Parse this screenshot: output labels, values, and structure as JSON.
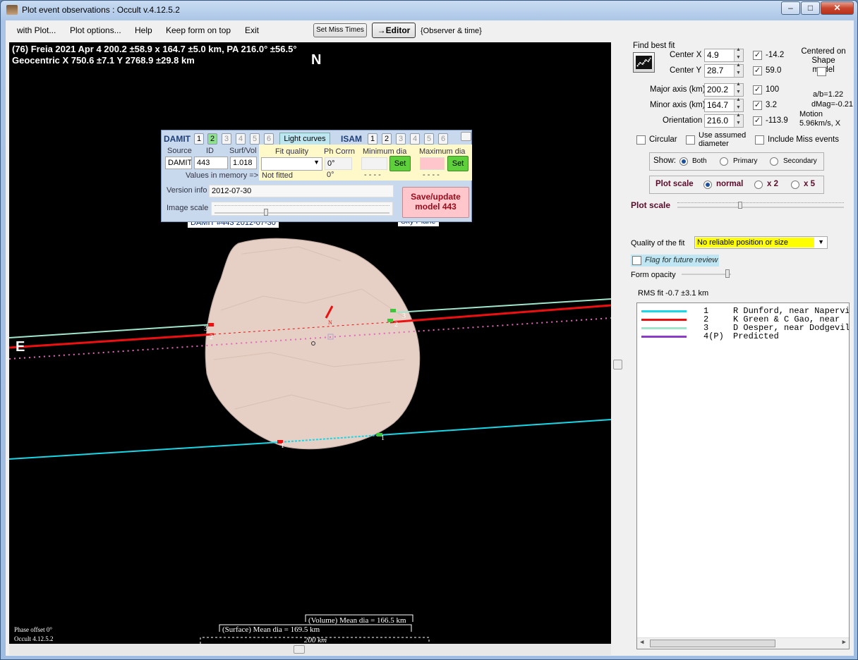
{
  "window": {
    "title": "Plot event observations : Occult v.4.12.5.2",
    "min_label": "–",
    "max_label": "□",
    "close_label": "✕"
  },
  "menu": {
    "items": [
      "with Plot...",
      "Plot options...",
      "Help",
      "Keep form on top",
      "Exit"
    ],
    "set_miss_times": "Set Miss Times",
    "editor": "→Editor",
    "observer_time": "{Observer & time}"
  },
  "plot": {
    "header_line1": "(76) Freia  2021 Apr 4   200.2 ±58.9 x 164.7 ±5.0 km,  PA 216.0° ±56.5°",
    "header_line2": "Geocentric  X  750.6 ±7.1   Y 2768.9 ±29.8 km",
    "north_label": "N",
    "east_label": "E",
    "damit_tag": "DAMIT #443 2012-07-30",
    "sky_plane_tag": "Sky Plane",
    "phase_offset": "Phase offset 0°",
    "occult_version": "Occult 4.12.5.2",
    "volume_mean": "(Volume) Mean dia = 166.5 km",
    "surface_mean": "(Surface) Mean dia = 169.5 km",
    "scale_bar": "200 km",
    "chord_labels": {
      "c1": "1",
      "c2": "2",
      "c3": "3",
      "n": "N"
    },
    "colors": {
      "chord1": "#18d8e8",
      "chord2": "#ee1010",
      "chord3": "#9fe6cc",
      "predicted": "#e26ab8",
      "body": "#e6cfc4"
    }
  },
  "damit_panel": {
    "damit_label": "DAMIT",
    "isam_label": "ISAM",
    "model_buttons": [
      "1",
      "2",
      "3",
      "4",
      "5",
      "6"
    ],
    "isam_buttons": [
      "1",
      "2",
      "3",
      "4",
      "5",
      "6"
    ],
    "light_curves": "Light curves",
    "col_source": "Source",
    "col_id": "ID",
    "col_surfvol": "Surf/Vol",
    "col_fitquality": "Fit quality",
    "col_phcorr": "Ph Corrn",
    "col_mindia": "Minimum dia",
    "col_maxdia": "Maximum dia",
    "source_value": "DAMIT",
    "id_value": "443",
    "surfvol_value": "1.018",
    "phcorr_value": "0°",
    "values_in_memory": "Values in memory =>",
    "not_fitted": "Not fitted",
    "mem_phcorr": "0°",
    "mem_min": "- - - -",
    "mem_max": "- - - -",
    "set_label": "Set",
    "version_label": "Version info",
    "version_value": "2012-07-30",
    "image_scale_label": "Image scale",
    "save_update": "Save/update model 443"
  },
  "right_panel": {
    "find_best_fit": "Find best fit",
    "center_x_label": "Center X",
    "center_x": "4.9",
    "center_x_extra": "-14.2",
    "center_y_label": "Center Y",
    "center_y": "28.7",
    "center_y_extra": "59.0",
    "centered_on_shape": "Centered on Shape model",
    "major_label": "Major axis (km)",
    "major": "200.2",
    "major_extra": "100",
    "minor_label": "Minor axis (km)",
    "minor": "164.7",
    "minor_extra": "3.2",
    "orient_label": "Orientation",
    "orient": "216.0",
    "orient_extra": "-113.9",
    "ab_ratio": "a/b=1.22",
    "dmag": "dMag=-0.21",
    "motion": "Motion",
    "motion_value": "5.96km/s, X",
    "circular": "Circular",
    "use_assumed": "Use assumed diameter",
    "include_miss": "Include Miss events",
    "show_label": "Show:",
    "show_both": "Both",
    "show_primary": "Primary",
    "show_secondary": "Secondary",
    "plot_scale_group": "Plot scale",
    "scale_normal": "normal",
    "scale_x2": "x 2",
    "scale_x5": "x 5",
    "plot_scale_slider": "Plot scale",
    "quality_label": "Quality of the fit",
    "quality_value": "No reliable position or size",
    "flag_review": "Flag for future review",
    "form_opacity": "Form opacity",
    "rms_fit": "RMS fit -0.7 ±3.1 km",
    "observers": [
      {
        "num": "1",
        "name": "R Dunford, near Napervi",
        "color": "#18d8e8"
      },
      {
        "num": "2",
        "name": "K Green & C Gao, near",
        "color": "#ee1010"
      },
      {
        "num": "3",
        "name": "D Oesper, near Dodgevil",
        "color": "#9fe6cc"
      },
      {
        "num": "4(P)",
        "name": "Predicted",
        "color": "#8a3cc8"
      }
    ]
  }
}
